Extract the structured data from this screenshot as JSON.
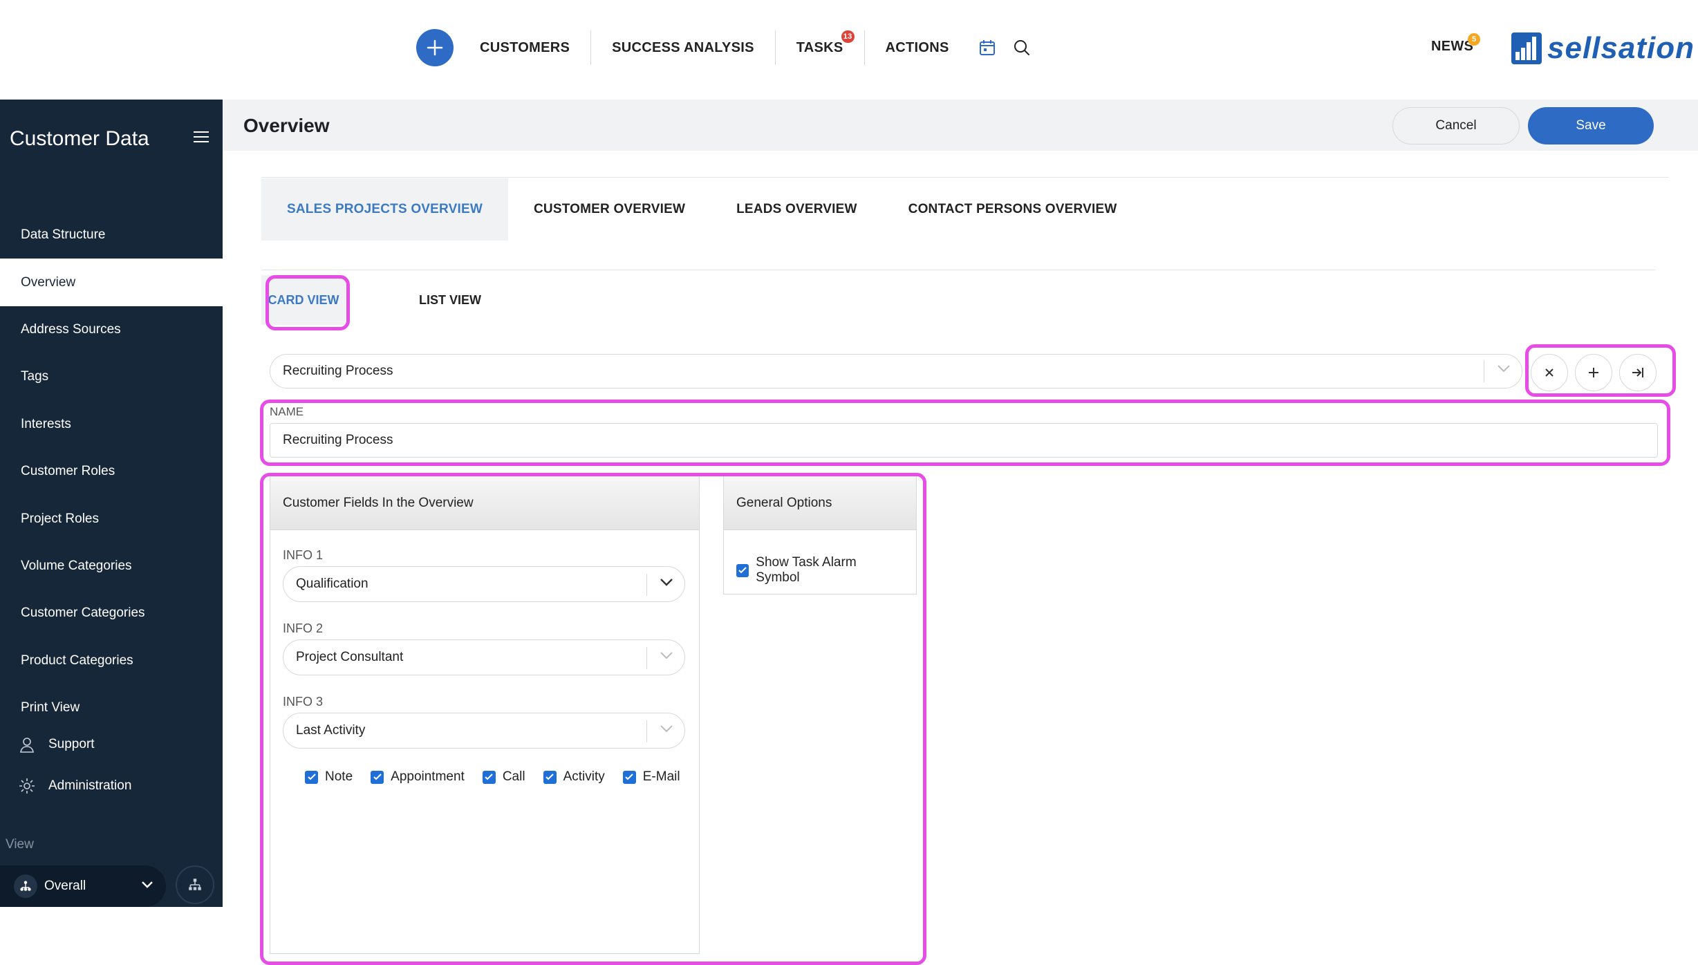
{
  "topnav": {
    "items": [
      {
        "label": "CUSTOMERS"
      },
      {
        "label": "SUCCESS ANALYSIS"
      },
      {
        "label": "TASKS",
        "badge": "13"
      },
      {
        "label": "ACTIONS"
      }
    ],
    "news_label": "NEWS",
    "news_badge": "5",
    "logo_text": "sellsation",
    "icons": [
      "plus-icon",
      "calendar-icon",
      "search-icon"
    ],
    "colors": {
      "brand": "#2d6bc4",
      "badge_red": "#d9443b",
      "badge_orange": "#f5a623"
    }
  },
  "sidebar": {
    "title": "Customer Data",
    "items": [
      {
        "label": "Data Structure",
        "active": false
      },
      {
        "label": "Overview",
        "active": true
      },
      {
        "label": "Address Sources",
        "active": false
      },
      {
        "label": "Tags",
        "active": false
      },
      {
        "label": "Interests",
        "active": false
      },
      {
        "label": "Customer Roles",
        "active": false
      },
      {
        "label": "Project Roles",
        "active": false
      },
      {
        "label": "Volume Categories",
        "active": false
      },
      {
        "label": "Customer Categories",
        "active": false
      },
      {
        "label": "Product Categories",
        "active": false
      },
      {
        "label": "Print View",
        "active": false
      }
    ],
    "support_label": "Support",
    "administration_label": "Administration",
    "view_label": "View",
    "view_value": "Overall",
    "colors": {
      "background": "#17273a"
    }
  },
  "header": {
    "title": "Overview",
    "cancel_label": "Cancel",
    "save_label": "Save"
  },
  "tabs": [
    {
      "label": "SALES PROJECTS OVERVIEW",
      "active": true
    },
    {
      "label": "CUSTOMER OVERVIEW",
      "active": false
    },
    {
      "label": "LEADS OVERVIEW",
      "active": false
    },
    {
      "label": "CONTACT PERSONS OVERVIEW",
      "active": false
    }
  ],
  "subtabs": {
    "card": "CARD VIEW",
    "list": "LIST VIEW"
  },
  "selector": {
    "value": "Recruiting Process"
  },
  "name": {
    "label": "NAME",
    "value": "Recruiting Process"
  },
  "customer_fields": {
    "title": "Customer Fields In the Overview",
    "fields": [
      {
        "label": "INFO 1",
        "value": "Qualification"
      },
      {
        "label": "INFO 2",
        "value": "Project Consultant"
      },
      {
        "label": "INFO 3",
        "value": "Last Activity"
      }
    ],
    "activity_types": [
      {
        "label": "Note",
        "checked": true
      },
      {
        "label": "Appointment",
        "checked": true
      },
      {
        "label": "Call",
        "checked": true
      },
      {
        "label": "Activity",
        "checked": true
      },
      {
        "label": "E-Mail",
        "checked": true
      }
    ]
  },
  "general_options": {
    "title": "General Options",
    "show_task_alarm_label": "Show Task Alarm Symbol",
    "show_task_alarm_checked": true
  },
  "highlight_color": "#e84ce6"
}
